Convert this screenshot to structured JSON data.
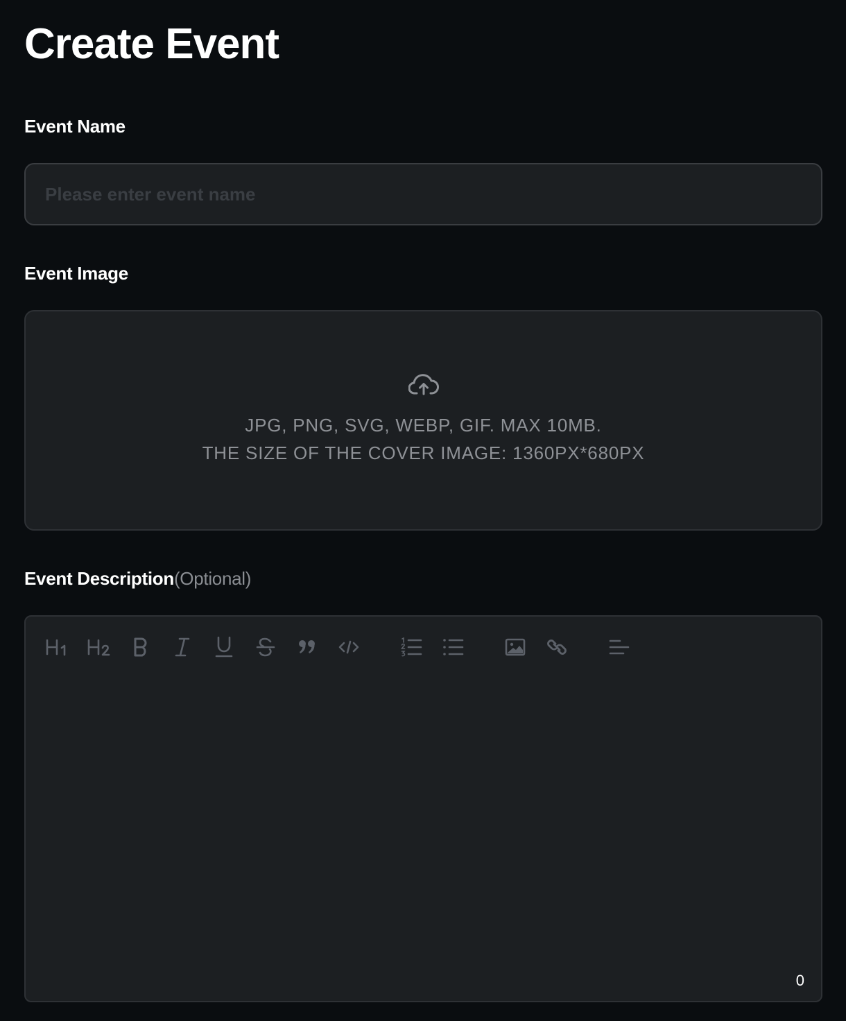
{
  "page": {
    "title": "Create Event"
  },
  "event_name": {
    "label": "Event Name",
    "placeholder": "Please enter event name",
    "value": ""
  },
  "event_image": {
    "label": "Event Image",
    "icon": "cloud-upload-icon",
    "hint_line1": "JPG, PNG, SVG, WEBP, GIF. MAX 10MB.",
    "hint_line2": "THE SIZE OF THE COVER IMAGE: 1360PX*680PX"
  },
  "event_description": {
    "label": "Event Description",
    "optional": "(Optional)",
    "value": "",
    "char_count": "0",
    "toolbar": [
      {
        "name": "heading-1",
        "icon": "heading-1-icon"
      },
      {
        "name": "heading-2",
        "icon": "heading-2-icon"
      },
      {
        "name": "bold",
        "icon": "bold-icon"
      },
      {
        "name": "italic",
        "icon": "italic-icon"
      },
      {
        "name": "underline",
        "icon": "underline-icon"
      },
      {
        "name": "strikethrough",
        "icon": "strikethrough-icon"
      },
      {
        "name": "blockquote",
        "icon": "quote-icon"
      },
      {
        "name": "code",
        "icon": "code-icon"
      },
      {
        "name": "ordered-list",
        "icon": "ordered-list-icon"
      },
      {
        "name": "bullet-list",
        "icon": "bullet-list-icon"
      },
      {
        "name": "image",
        "icon": "image-icon"
      },
      {
        "name": "link",
        "icon": "link-icon"
      },
      {
        "name": "align",
        "icon": "align-left-icon"
      }
    ]
  },
  "colors": {
    "background": "#0a0d10",
    "field_background": "#1c1f22",
    "field_border": "#3a3d41",
    "muted_text": "#8e9196",
    "toolbar_icon": "#5c6169"
  }
}
